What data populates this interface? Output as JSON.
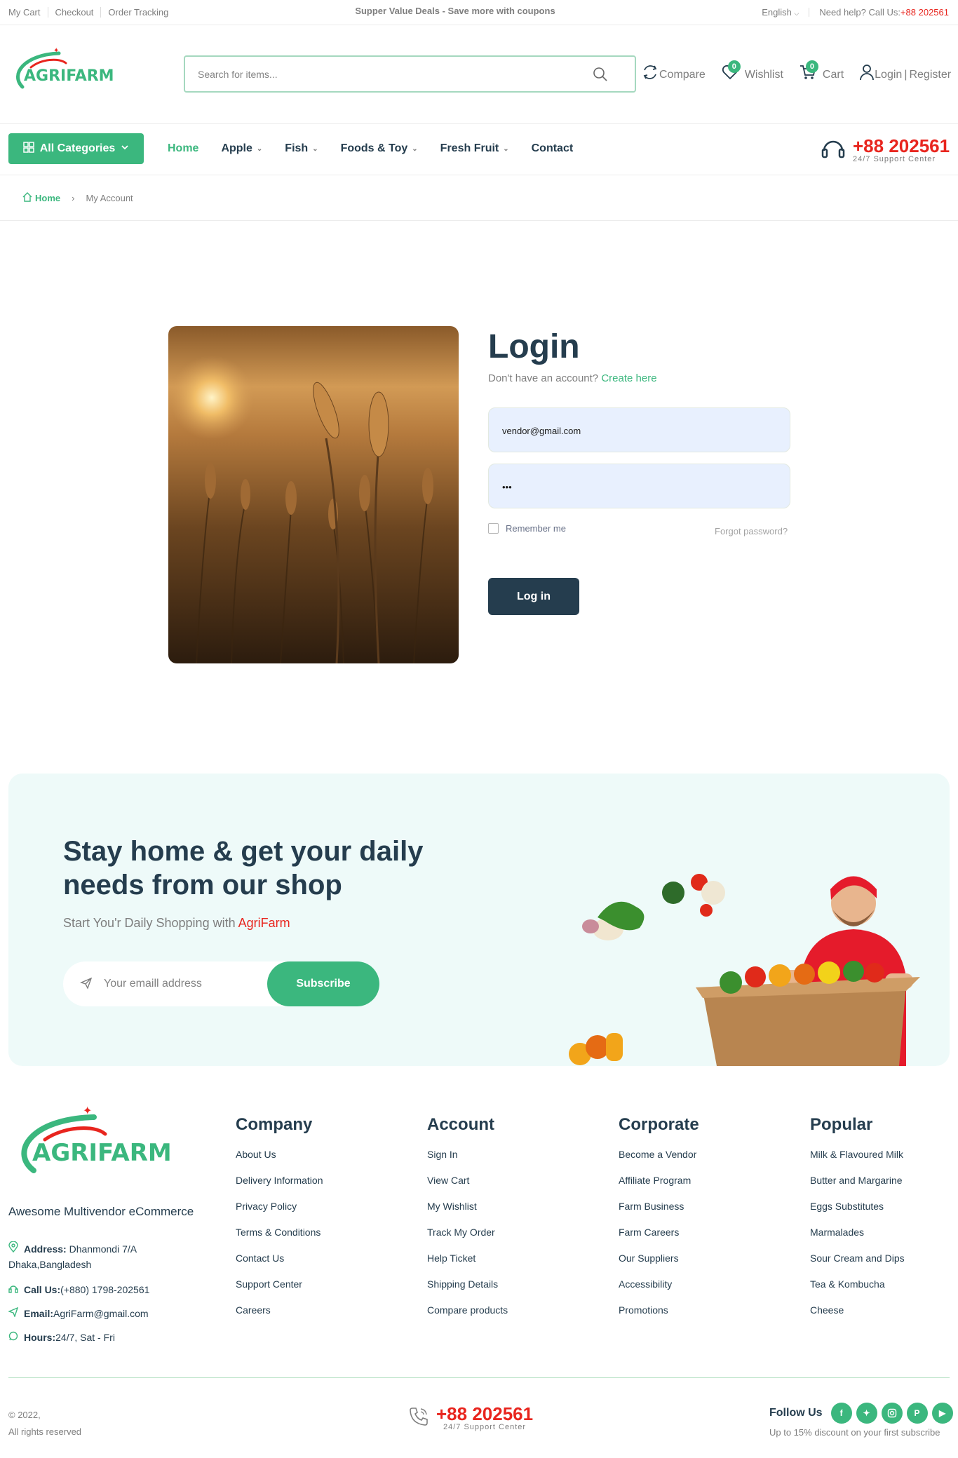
{
  "topbar": {
    "links": [
      "My Cart",
      "Checkout",
      "Order Tracking"
    ],
    "promo": "Supper Value Deals - Save more with coupons",
    "language": "English",
    "help_label": "Need help? Call Us:",
    "help_phone": "+88 202561"
  },
  "header": {
    "logo_text": "AGRIFARM",
    "search_placeholder": "Search for items...",
    "compare_label": "Compare",
    "wishlist_label": "Wishlist",
    "wishlist_count": "0",
    "cart_label": "Cart",
    "cart_count": "0",
    "login_label": "Login",
    "register_label": "Register"
  },
  "nav": {
    "categories_label": "All Categories",
    "items": [
      {
        "label": "Home",
        "dropdown": false
      },
      {
        "label": "Apple",
        "dropdown": true
      },
      {
        "label": "Fish",
        "dropdown": true
      },
      {
        "label": "Foods & Toy",
        "dropdown": true
      },
      {
        "label": "Fresh Fruit",
        "dropdown": true
      },
      {
        "label": "Contact",
        "dropdown": false
      }
    ],
    "support_phone": "+88 202561",
    "support_label": "24/7 Support Center"
  },
  "breadcrumb": {
    "home": "Home",
    "separator": "›",
    "current": "My Account"
  },
  "login": {
    "title": "Login",
    "no_account_text": "Don't have an account?",
    "create_link": "Create here",
    "email_value": "vendor@gmail.com",
    "password_value": "•••",
    "remember_label": "Remember me",
    "forgot_label": "Forgot password?",
    "submit_label": "Log in"
  },
  "newsletter": {
    "title": "Stay home & get your daily needs from our shop",
    "subtitle_prefix": "Start You'r Daily Shopping with",
    "subtitle_brand": "AgriFarm",
    "email_placeholder": "Your emaill address",
    "subscribe_label": "Subscribe"
  },
  "footer": {
    "logo_text": "AGRIFARM",
    "tagline": "Awesome Multivendor eCommerce",
    "address_label": "Address:",
    "address_value": "Dhanmondi 7/A",
    "address_city": "Dhaka,Bangladesh",
    "call_label": "Call Us:",
    "call_value": "(+880) 1798-202561",
    "email_label": "Email:",
    "email_value": "AgriFarm@gmail.com",
    "hours_label": "Hours:",
    "hours_value": "24/7, Sat - Fri",
    "columns": [
      {
        "title": "Company",
        "items": [
          "About Us",
          "Delivery Information",
          "Privacy Policy",
          "Terms & Conditions",
          "Contact Us",
          "Support Center",
          "Careers"
        ]
      },
      {
        "title": "Account",
        "items": [
          "Sign In",
          "View Cart",
          "My Wishlist",
          "Track My Order",
          "Help Ticket",
          "Shipping Details",
          "Compare products"
        ]
      },
      {
        "title": "Corporate",
        "items": [
          "Become a Vendor",
          "Affiliate Program",
          "Farm Business",
          "Farm Careers",
          "Our Suppliers",
          "Accessibility",
          "Promotions"
        ]
      },
      {
        "title": "Popular",
        "items": [
          "Milk & Flavoured Milk",
          "Butter and Margarine",
          "Eggs Substitutes",
          "Marmalades",
          "Sour Cream and Dips",
          "Tea & Kombucha",
          "Cheese"
        ]
      }
    ],
    "copyright": "© 2022,",
    "rights": "All rights reserved",
    "support_phone": "+88 202561",
    "support_label": "24/7 Support Center",
    "follow_label": "Follow Us",
    "social": [
      "facebook",
      "twitter",
      "instagram",
      "pinterest",
      "youtube"
    ],
    "discount_text": "Up to 15% discount on your first subscribe"
  },
  "colors": {
    "brand_green": "#3bb77e",
    "dark_navy": "#253d4e",
    "accent_red": "#e8251e",
    "newsletter_bg": "#eefaf9",
    "input_bg": "#e8f0fe"
  }
}
